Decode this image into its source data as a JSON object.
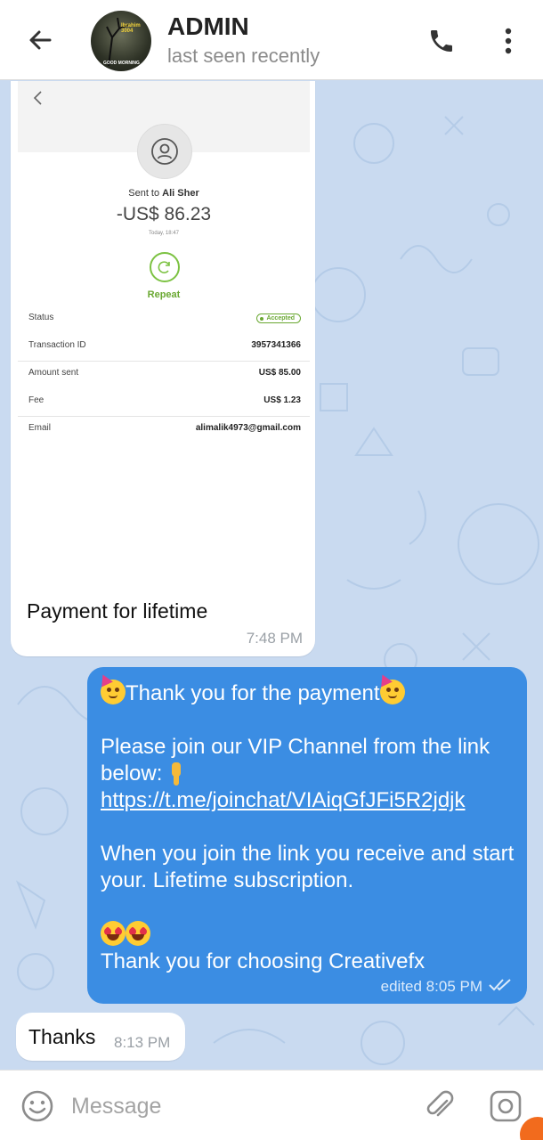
{
  "header": {
    "title": "ADMIN",
    "subtitle": "last seen recently",
    "avatar_text_top": "Ibrahim 3004",
    "avatar_text_bottom": "GOOD MORNING"
  },
  "messages": {
    "photo": {
      "sent_to_prefix": "Sent to",
      "recipient": "Ali Sher",
      "amount": "-US$ 86.23",
      "date": "Today, 18:47",
      "repeat_label": "Repeat",
      "rows": [
        {
          "label": "Status",
          "value": "Accepted"
        },
        {
          "label": "Transaction ID",
          "value": "3957341366"
        },
        {
          "label": "Amount sent",
          "value": "US$ 85.00"
        },
        {
          "label": "Fee",
          "value": "US$ 1.23"
        },
        {
          "label": "Email",
          "value": "alimalik4973@gmail.com"
        }
      ],
      "caption": "Payment for lifetime",
      "time": "7:48 PM"
    },
    "outgoing": {
      "line1": "Thank you for the payment",
      "line2a": "Please join our VIP Channel from the link below: ",
      "link": "https://t.me/joinchat/VIAiqGfJFi5R2jdjk",
      "line3": "When you join the link you receive and start your. Lifetime subscription.",
      "line4": "Thank you for choosing Creativefx",
      "meta": "edited 8:05 PM"
    },
    "thanks": {
      "text": "Thanks",
      "time": "8:13 PM"
    }
  },
  "input": {
    "placeholder": "Message"
  },
  "colors": {
    "outgoing_bubble": "#3b8de3",
    "chat_background": "#c9daf0",
    "accent_green": "#6aa832"
  }
}
